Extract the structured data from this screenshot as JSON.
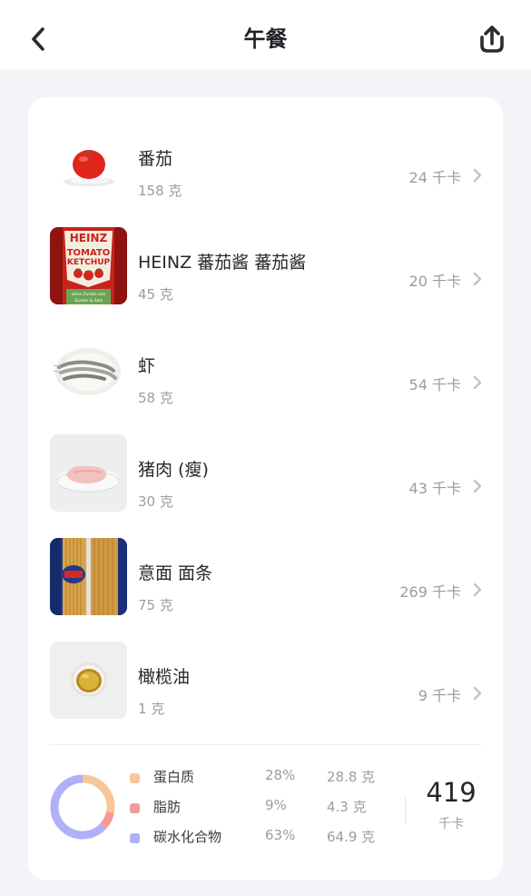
{
  "header": {
    "title": "午餐",
    "back_icon": "chevron-left-icon",
    "share_icon": "share-upload-icon"
  },
  "foods": [
    {
      "name": "番茄",
      "weight": "158 克",
      "kcal": "24 千卡",
      "image": "tomato"
    },
    {
      "name": "HEINZ 蕃茄酱 蕃茄酱",
      "weight": "45 克",
      "kcal": "20 千卡",
      "image": "ketchup-bottle"
    },
    {
      "name": "虾",
      "weight": "58 克",
      "kcal": "54 千卡",
      "image": "shrimp-plate"
    },
    {
      "name": "猪肉 (瘦)",
      "weight": "30 克",
      "kcal": "43 千卡",
      "image": "lean-pork-plate"
    },
    {
      "name": "意面 面条",
      "weight": "75 克",
      "kcal": "269 千卡",
      "image": "pasta-package"
    },
    {
      "name": "橄榄油",
      "weight": "1 克",
      "kcal": "9 千卡",
      "image": "olive-oil-bowl"
    }
  ],
  "ketchup_label": {
    "brand": "HEINZ",
    "line1": "TOMATO",
    "line2": "KETCHUP",
    "footer1": "ohne Zusatz von",
    "footer2": "Zucker & Salz"
  },
  "summary": {
    "macros": [
      {
        "name": "蛋白质",
        "percent": "28%",
        "grams": "28.8 克",
        "color": "#f7c79a",
        "share": 0.28
      },
      {
        "name": "脂肪",
        "percent": "9%",
        "grams": "4.3 克",
        "color": "#f49a96",
        "share": 0.09
      },
      {
        "name": "碳水化合物",
        "percent": "63%",
        "grams": "64.9 克",
        "color": "#aeb1f7",
        "share": 0.63
      }
    ],
    "total_kcal": "419",
    "total_unit": "千卡"
  }
}
